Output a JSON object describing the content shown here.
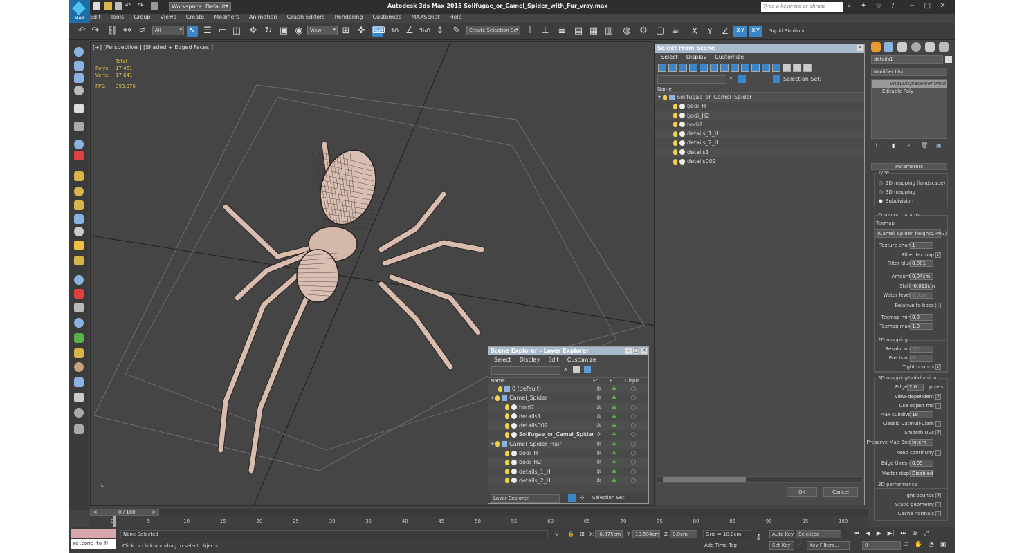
{
  "app": {
    "title": "Autodesk 3ds Max  2015    Solifugae_or_Camel_Spider_with_Fur_vray.max",
    "logo_text": "MAX",
    "workspace": "Workspace: Default",
    "search_placeholder": "Type a keyword or phrase"
  },
  "menu": [
    "Edit",
    "Tools",
    "Group",
    "Views",
    "Create",
    "Modifiers",
    "Animation",
    "Graph Editors",
    "Rendering",
    "Customize",
    "MAXScript",
    "Help"
  ],
  "toolbar": {
    "filter": "All",
    "ref_coord": "View",
    "num1": "3",
    "num2": "%",
    "selection_set_placeholder": "Create Selection Se",
    "axis": [
      "X",
      "Y",
      "Z",
      "XY",
      "XY"
    ],
    "studio": "Squid Studio v"
  },
  "viewport": {
    "label": "[+] [Perspective ] [Shaded + Edged Faces ]",
    "stats": {
      "total_label": "Total",
      "polys_label": "Polys:",
      "polys": "17 461",
      "verts_label": "Verts:",
      "verts": "17 641",
      "fps_label": "FPS:",
      "fps": "393,976"
    }
  },
  "select_from_scene": {
    "title": "Select From Scene",
    "menu": [
      "Select",
      "Display",
      "Customize"
    ],
    "selection_set_label": "Selection Set:",
    "col_name": "Name",
    "root": "Solifugae_or_Camel_Spider",
    "items": [
      "bodi_H",
      "bodi_H2",
      "bodi2",
      "details_1_H",
      "details_2_H",
      "details1",
      "details002"
    ],
    "ok": "OK",
    "cancel": "Cancel"
  },
  "scene_explorer": {
    "title": "Scene Explorer - Layer Explorer",
    "menu": [
      "Select",
      "Display",
      "Edit",
      "Customize"
    ],
    "cols": [
      "Name",
      "Fr...",
      "R...",
      "Displa..."
    ],
    "rows": [
      {
        "name": "0 (default)",
        "indent": 1
      },
      {
        "name": "Camel_Spider",
        "indent": 0
      },
      {
        "name": "bodi2",
        "indent": 2
      },
      {
        "name": "details1",
        "indent": 2
      },
      {
        "name": "details002",
        "indent": 2
      },
      {
        "name": "Solifugae_or_Camel_Spider",
        "indent": 2
      },
      {
        "name": "Camel_Spider_Hair",
        "indent": 0
      },
      {
        "name": "bodi_H",
        "indent": 2
      },
      {
        "name": "bodi_H2",
        "indent": 2
      },
      {
        "name": "details_1_H",
        "indent": 2
      },
      {
        "name": "details_2_H",
        "indent": 2
      }
    ],
    "footer_dropdown": "Layer Explorer",
    "selection_set_label": "Selection Set:"
  },
  "command_panel": {
    "object_name": "details1",
    "modifier_list": "Modifier List",
    "stack": [
      "VRayDisplacementMod",
      "Editable Poly"
    ],
    "rollout": "Parameters",
    "type_label": "Type",
    "type_options": [
      "2D mapping (landscape)",
      "3D mapping",
      "Subdivision"
    ],
    "common_params": "Common params",
    "texmap_label": "Texmap",
    "texmap_value": "(Camel_Spider_heights.PNG)",
    "common_rows": [
      {
        "label": "Texture chan",
        "value": "1",
        "disabled": false
      },
      {
        "label": "Filter texmap",
        "check": "✓"
      },
      {
        "label": "Filter blur",
        "value": "0,001",
        "disabled": false
      },
      {
        "label": "Amount",
        "value": "0,04cm",
        "disabled": false
      },
      {
        "label": "Shift",
        "value": "-0,013cm",
        "disabled": false
      },
      {
        "label": "Water level",
        "value": "0,0cm",
        "disabled": true
      },
      {
        "label": "Relative to bbox",
        "check": ""
      },
      {
        "label": "Texmap min",
        "value": "0,0",
        "disabled": false
      },
      {
        "label": "Texmap max",
        "value": "1,0",
        "disabled": false
      }
    ],
    "mapping2d_label": "2D mapping",
    "mapping2d_rows": [
      {
        "label": "Resolution",
        "value": "512",
        "disabled": true
      },
      {
        "label": "Precision",
        "value": "8",
        "disabled": true
      },
      {
        "label": "Tight bounds",
        "check": "✓"
      }
    ],
    "mapping3d_label": "3D mapping/subdivision",
    "edge_length_label": "Edge length",
    "edge_length_value": "2,0",
    "pixels_label": "pixels",
    "mapping3d_rows": [
      {
        "label": "View-dependent",
        "check": "✓"
      },
      {
        "label": "Use object mtl",
        "check": ""
      },
      {
        "label": "Max subdivs",
        "value": "18",
        "disabled": false
      },
      {
        "label": "Classic Catmull-Clark",
        "check": ""
      },
      {
        "label": "Smooth UVs",
        "check": "✓"
      },
      {
        "label": "Preserve Map Bnd",
        "value": "Intern",
        "disabled": false
      },
      {
        "label": "Keep continuity",
        "check": ""
      },
      {
        "label": "Edge thresh",
        "value": "0,05",
        "disabled": false
      },
      {
        "label": "Vector displ",
        "value": "Disabled",
        "disabled": false
      }
    ],
    "perf_label": "3D performance",
    "perf_rows": [
      {
        "label": "Tight bounds",
        "check": "✓"
      },
      {
        "label": "Static geometry",
        "check": ""
      },
      {
        "label": "Cache normals",
        "check": ""
      }
    ]
  },
  "timeline": {
    "frame": "0 / 100",
    "ticks": [
      "0",
      "5",
      "10",
      "15",
      "20",
      "25",
      "30",
      "35",
      "40",
      "45",
      "50",
      "55",
      "60",
      "65",
      "70",
      "75",
      "80",
      "85",
      "90",
      "95",
      "100"
    ]
  },
  "status": {
    "maxscript": "Welcome to M",
    "selection": "None Selected",
    "prompt": "Click or click-and-drag to select objects",
    "x_label": "X:",
    "x": "-6,875cm",
    "y_label": "Y:",
    "y": "10,594cm",
    "z_label": "Z:",
    "z": "0,0cm",
    "grid": "Grid = 10,0cm",
    "add_time_tag": "Add Time Tag",
    "auto_key": "Auto Key",
    "selected": "Selected",
    "set_key": "Set Key",
    "key_filters": "Key Filters...",
    "frame_field": "0"
  }
}
